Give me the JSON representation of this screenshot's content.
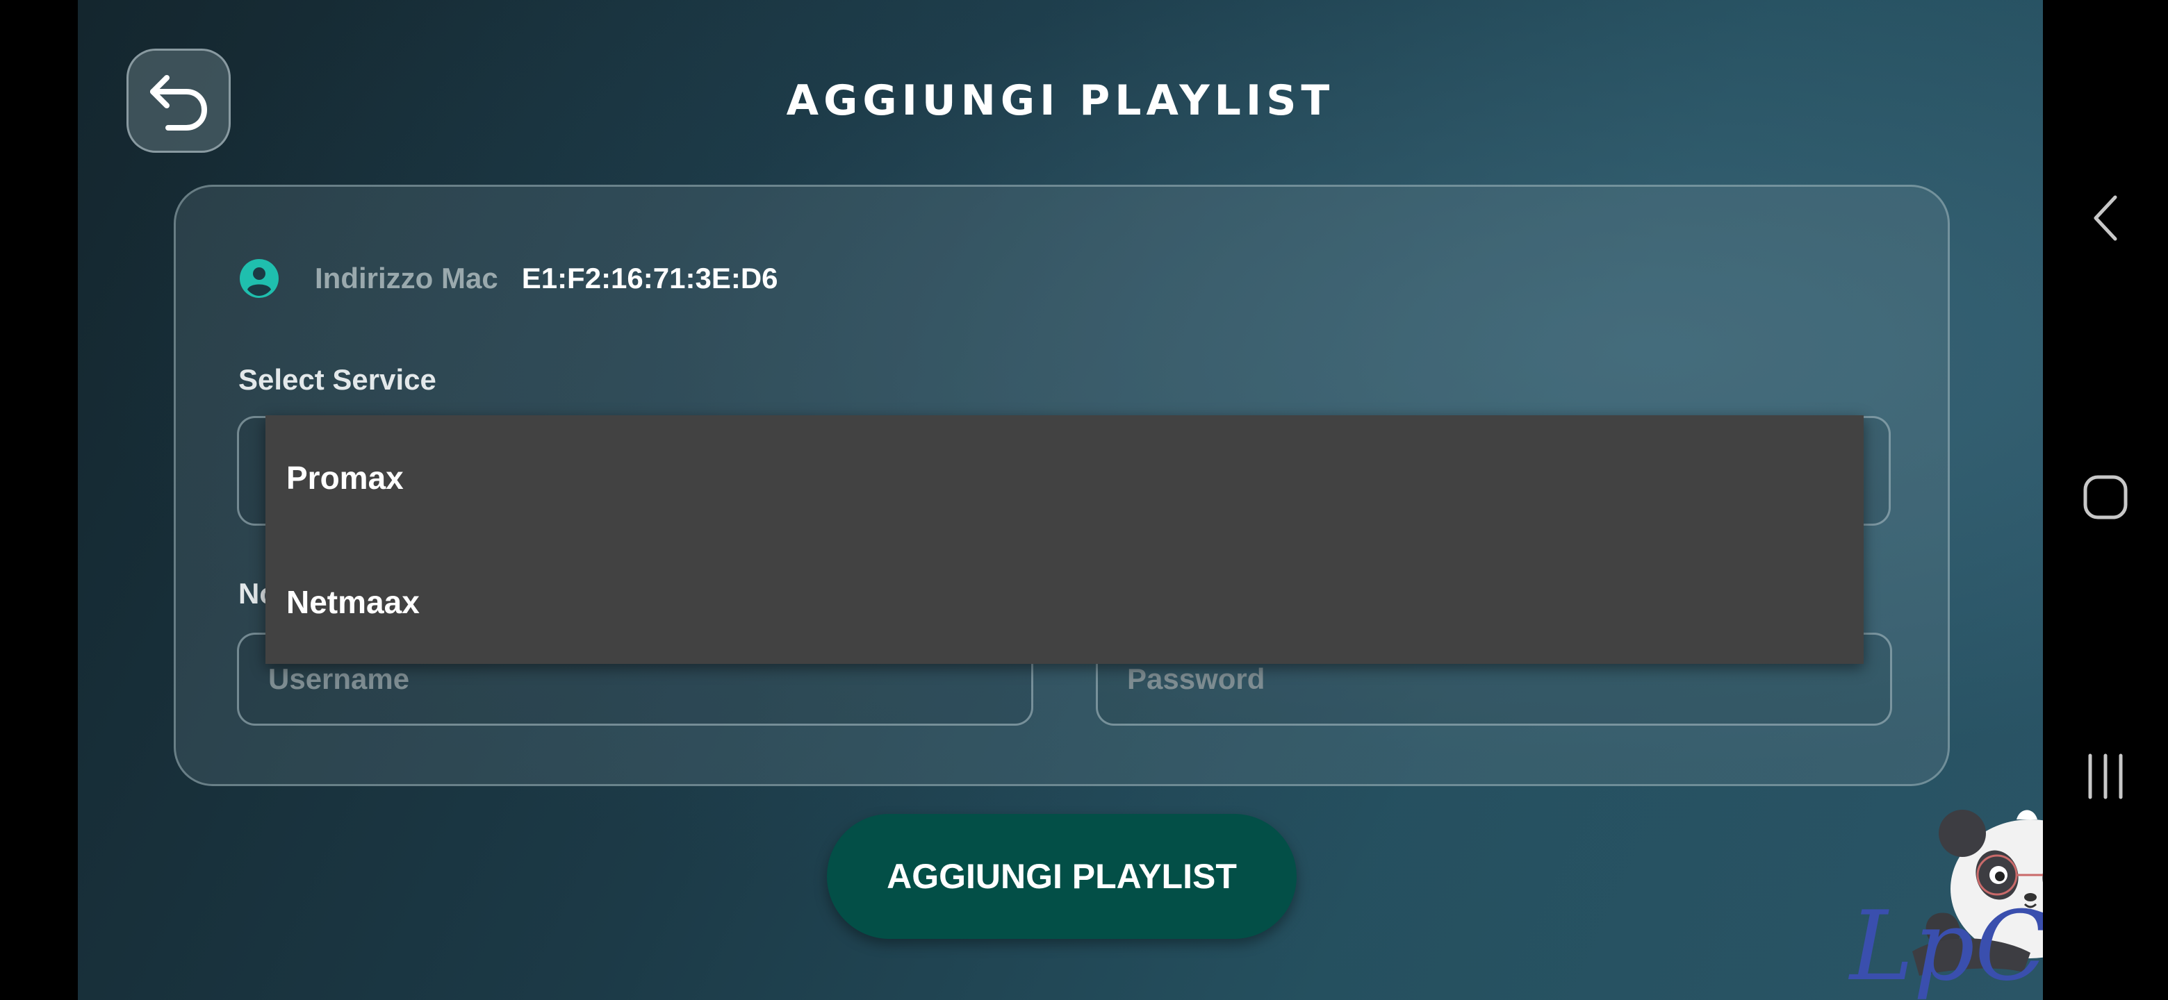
{
  "app": {
    "title": "AGGIUNGI PLAYLIST"
  },
  "header": {
    "back_icon": "undo-arrow-icon"
  },
  "form": {
    "mac_icon": "user-circle-icon",
    "mac_label": "Indirizzo Mac",
    "mac_value": "E1:F2:16:71:3E:D6",
    "service_label": "Select Service",
    "name_label_visible": "No",
    "username_placeholder": "Username",
    "password_placeholder": "Password",
    "submit_label": "AGGIUNGI PLAYLIST"
  },
  "dropdown": {
    "options": [
      {
        "label": "Promax"
      },
      {
        "label": "Netmaax"
      }
    ]
  },
  "watermark": {
    "text": "LpCodes",
    "icon": "panda-mascot-icon"
  },
  "system_nav": {
    "back_icon": "chevron-left-icon",
    "home_icon": "home-square-icon",
    "recents_icon": "recents-bars-icon"
  },
  "colors": {
    "accent": "#1fbfae",
    "button": "#034f47",
    "dropdown_bg": "#424242",
    "watermark": "#3a4fae"
  }
}
